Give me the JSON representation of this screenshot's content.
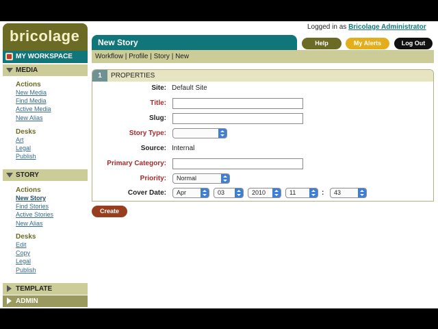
{
  "brand": {
    "name": "bricolage"
  },
  "sidebar": {
    "workspace_label": "MY WORKSPACE",
    "media": {
      "title": "MEDIA",
      "actions_title": "Actions",
      "actions": [
        "New Media",
        "Find Media",
        "Active Media",
        "New Alias"
      ],
      "desks_title": "Desks",
      "desks": [
        "Art",
        "Legal",
        "Publish"
      ]
    },
    "story": {
      "title": "STORY",
      "actions_title": "Actions",
      "actions": [
        "New Story",
        "Find Stories",
        "Active Stories",
        "New Alias"
      ],
      "desks_title": "Desks",
      "desks": [
        "Edit",
        "Copy",
        "Legal",
        "Publish"
      ]
    },
    "template": {
      "title": "TEMPLATE"
    },
    "admin": {
      "title": "ADMIN"
    }
  },
  "header": {
    "logged_prefix": "Logged in as",
    "user": "Bricolage Administrator",
    "help_label": "Help",
    "alerts_label": "My Alerts",
    "logout_label": "Log Out"
  },
  "page": {
    "title": "New Story",
    "breadcrumb": "Workflow | Profile | Story | New"
  },
  "properties": {
    "number": "1",
    "title": "PROPERTIES",
    "site_label": "Site:",
    "site_value": "Default Site",
    "title_label": "Title:",
    "title_value": "",
    "slug_label": "Slug:",
    "slug_value": "",
    "story_type_label": "Story Type:",
    "story_type_value": "",
    "source_label": "Source:",
    "source_value": "Internal",
    "primary_category_label": "Primary Category:",
    "primary_category_value": "",
    "priority_label": "Priority:",
    "priority_value": "Normal",
    "cover_date_label": "Cover Date:",
    "cover_date": {
      "month": "Apr",
      "day": "03",
      "year": "2010",
      "hour": "11",
      "minute": "43"
    },
    "time_separator": ":"
  },
  "create_label": "Create",
  "colors": {
    "teal": "#11767a",
    "olive": "#6b6b26",
    "khaki": "#cccc99",
    "required": "#a52a2a",
    "alerts": "#e4ad1c",
    "create": "#993d1f"
  }
}
